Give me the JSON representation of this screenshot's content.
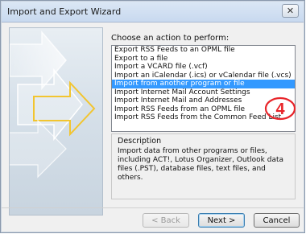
{
  "window": {
    "title": "Import and Export Wizard",
    "close_glyph": "✕"
  },
  "main": {
    "prompt": "Choose an action to perform:",
    "actions": [
      "Export RSS Feeds to an OPML file",
      "Export to a file",
      "Import a VCARD file (.vcf)",
      "Import an iCalendar (.ics) or vCalendar file (.vcs)",
      "Import from another program or file",
      "Import Internet Mail Account Settings",
      "Import Internet Mail and Addresses",
      "Import RSS Feeds from an OPML file",
      "Import RSS Feeds from the Common Feed List"
    ],
    "selected_index": 4,
    "step_badge": "4",
    "description": {
      "legend": "Description",
      "text": "Import data from other programs or files, including ACT!, Lotus Organizer, Outlook data files (.PST), database files, text files, and others."
    }
  },
  "buttons": {
    "back": "< Back",
    "next": "Next >",
    "cancel": "Cancel"
  },
  "colors": {
    "selection": "#3399ff",
    "badge": "#e8252a"
  }
}
